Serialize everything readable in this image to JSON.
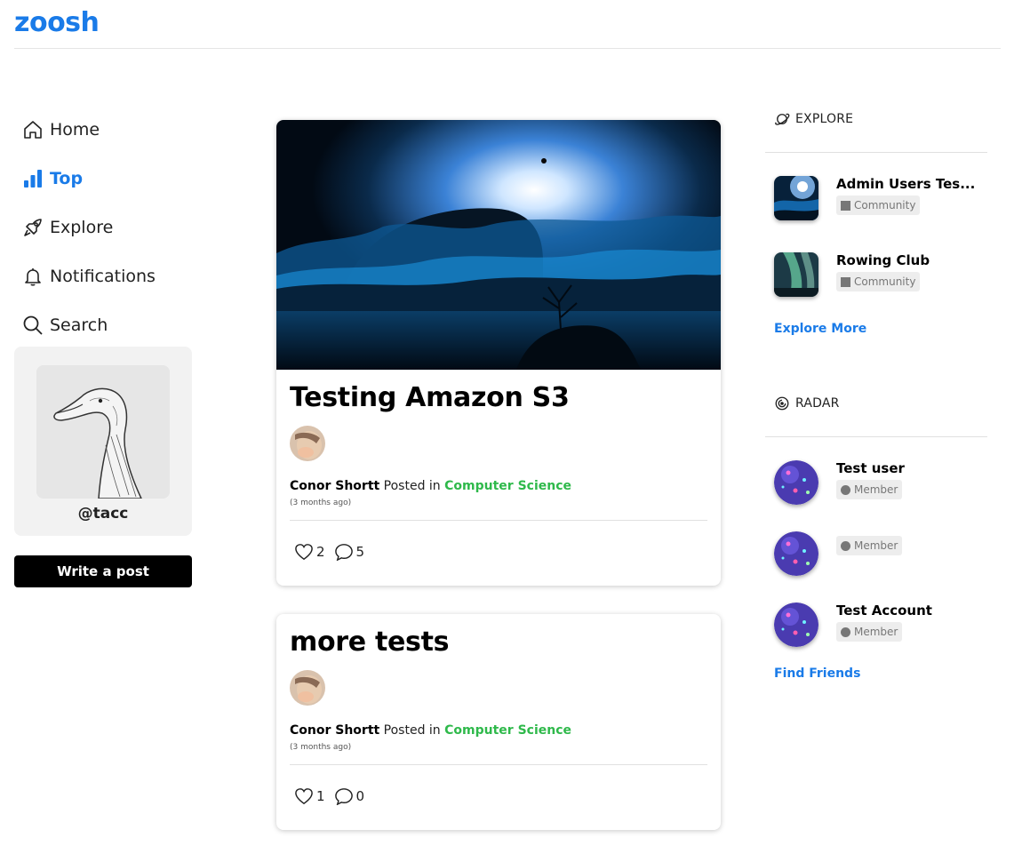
{
  "app": {
    "logo": "zoosh"
  },
  "nav": {
    "items": [
      {
        "label": "Home",
        "icon": "home-icon"
      },
      {
        "label": "Top",
        "icon": "bar-chart-icon",
        "active": true
      },
      {
        "label": "Explore",
        "icon": "rocket-icon"
      },
      {
        "label": "Notifications",
        "icon": "bell-icon"
      },
      {
        "label": "Search",
        "icon": "search-icon"
      }
    ]
  },
  "profile": {
    "handle": "@tacc"
  },
  "write_button": "Write a post",
  "posts": [
    {
      "title": "Testing Amazon S3",
      "author": "Conor Shortt",
      "posted_in": "Posted in",
      "category": "Computer Science",
      "time": "(3 months ago)",
      "likes": "2",
      "comments": "5"
    },
    {
      "title": "more tests",
      "author": "Conor Shortt",
      "posted_in": "Posted in",
      "category": "Computer Science",
      "time": "(3 months ago)",
      "likes": "1",
      "comments": "0"
    }
  ],
  "explore": {
    "heading": "EXPLORE",
    "items": [
      {
        "name": "Admin Users Tes...",
        "badge": "Community"
      },
      {
        "name": "Rowing Club",
        "badge": "Community"
      }
    ],
    "more_link": "Explore More"
  },
  "radar": {
    "heading": "RADAR",
    "items": [
      {
        "name": "Test user",
        "badge": "Member"
      },
      {
        "name": "",
        "badge": "Member"
      },
      {
        "name": "Test Account",
        "badge": "Member"
      }
    ],
    "more_link": "Find Friends"
  },
  "colors": {
    "accent": "#1a7be8",
    "category": "#2fb94b"
  }
}
